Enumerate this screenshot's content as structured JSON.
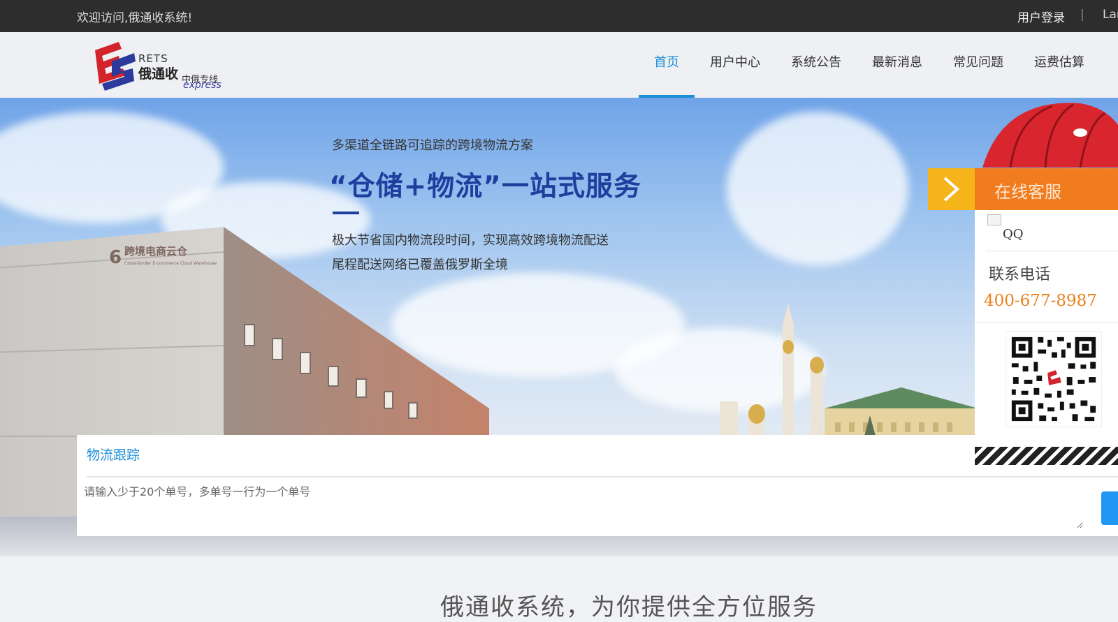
{
  "topbar": {
    "welcome": "欢迎访问,俄通收系统!",
    "login": "用户登录",
    "separator": "|",
    "language": "Lan"
  },
  "logo": {
    "rets": "RETS",
    "name": "俄通收",
    "sub": "中俄专线",
    "express": "express"
  },
  "nav": {
    "items": [
      {
        "label": "首页",
        "active": true
      },
      {
        "label": "用户中心"
      },
      {
        "label": "系统公告"
      },
      {
        "label": "最新消息"
      },
      {
        "label": "常见问题"
      },
      {
        "label": "运费估算"
      }
    ]
  },
  "banner": {
    "subtitle": "多渠道全链路可追踪的跨境物流方案",
    "title": "“仓储+物流”一站式服务",
    "desc_1": "极大节省国内物流段时间，实现高效跨境物流配送",
    "desc_2": "尾程配送网络已覆盖俄罗斯全境",
    "building_sign": "跨境电商云仓",
    "building_sign_en": "Cross-border E-commerce Cloud Warehouse",
    "building_number": "6"
  },
  "tracking": {
    "title": "物流跟踪",
    "placeholder": "请输入少于20个单号，多单号一行为一个单号"
  },
  "section": {
    "title": "俄通收系统，为你提供全方位服务"
  },
  "service": {
    "title": "在线客服",
    "qq_alt": "QQ",
    "tel_label": "联系电话",
    "tel": "400-677-8987"
  },
  "colors": {
    "accent": "#1e8fd6",
    "service_orange": "#f07c1e",
    "arrow_yellow": "#f5b41a",
    "slogan_blue": "#1f3f9e",
    "topbar": "#2d2d2d"
  }
}
